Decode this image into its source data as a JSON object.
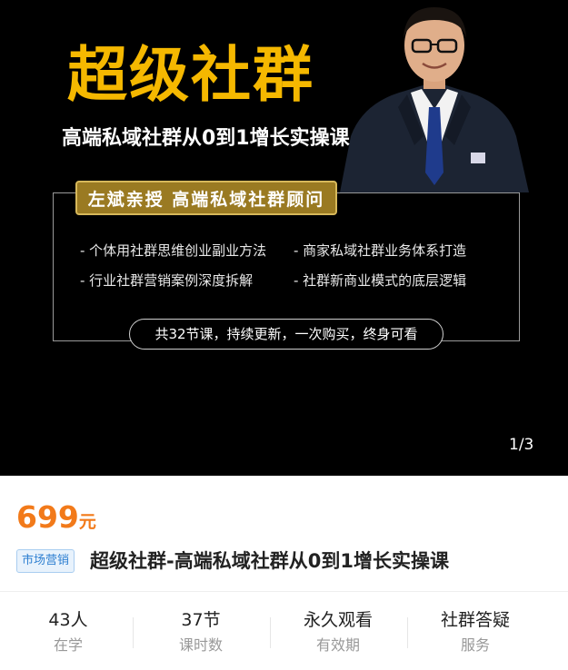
{
  "banner": {
    "title": "超级社群",
    "subtitle": "高端私域社群从0到1增长实操课",
    "instructor_badge": "左斌亲授  高端私域社群顾问",
    "features": [
      "- 个体用社群思维创业副业方法",
      "- 商家私域社群业务体系打造",
      "- 行业社群营销案例深度拆解",
      "- 社群新商业模式的底层逻辑"
    ],
    "lesson_note": "共32节课，持续更新，一次购买，终身可看",
    "image_counter": "1/3"
  },
  "product": {
    "price_value": "699",
    "price_unit": "元",
    "category_tag": "市场营销",
    "title": "超级社群-高端私域社群从0到1增长实操课"
  },
  "stats": [
    {
      "value": "43人",
      "label": "在学"
    },
    {
      "value": "37节",
      "label": "课时数"
    },
    {
      "value": "永久观看",
      "label": "有效期"
    },
    {
      "value": "社群答疑",
      "label": "服务"
    }
  ],
  "colors": {
    "title_gold": "#f5b800",
    "price_orange": "#f27a1a",
    "tag_blue": "#2f80d1",
    "badge_gold": "#9a7a22"
  }
}
